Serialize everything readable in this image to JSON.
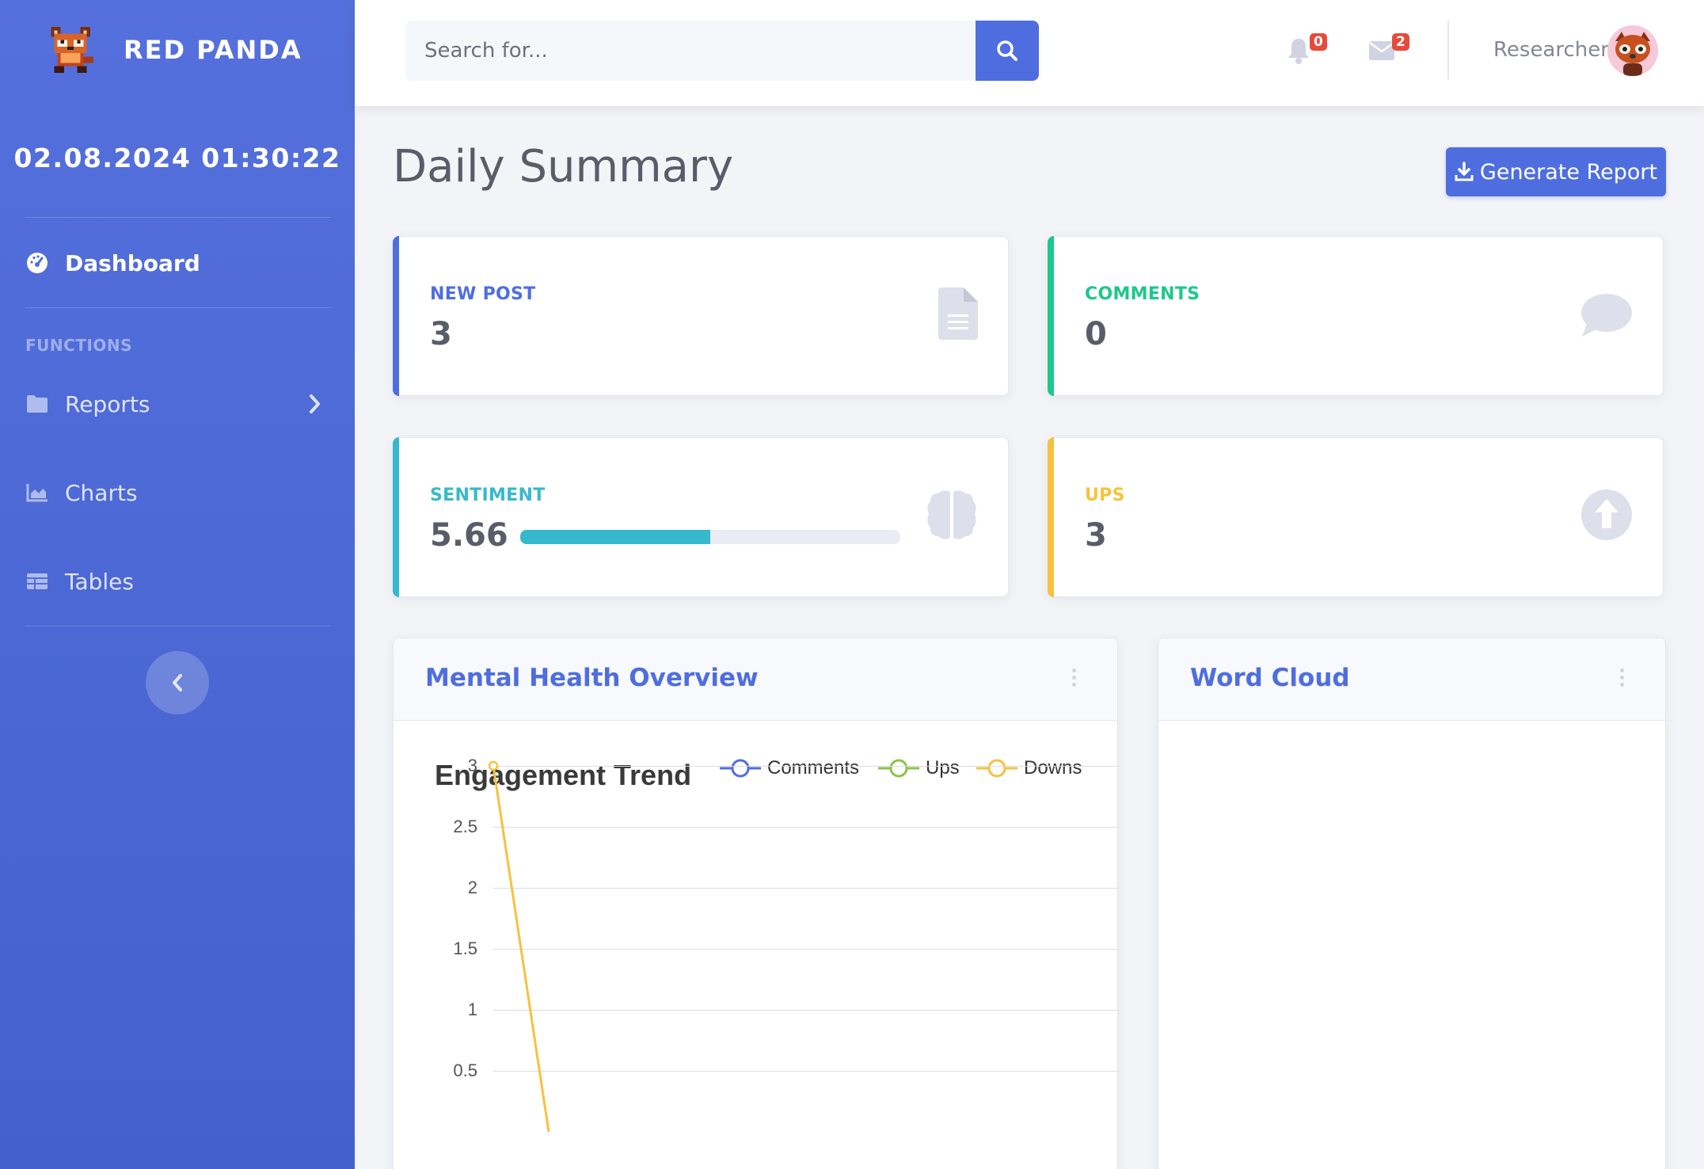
{
  "sidebar": {
    "brand": "RED PANDA",
    "clock": "02.08.2024 01:30:22",
    "dashboard_label": "Dashboard",
    "section_heading": "FUNCTIONS",
    "items": [
      {
        "label": "Reports"
      },
      {
        "label": "Charts"
      },
      {
        "label": "Tables"
      }
    ]
  },
  "topbar": {
    "search_placeholder": "Search for...",
    "alerts_count": "0",
    "messages_count": "2",
    "user_name": "Researcher"
  },
  "main": {
    "title": "Daily Summary",
    "generate_report": "Generate Report",
    "cards": {
      "new_post": {
        "label": "NEW POST",
        "value": "3",
        "color": "#4e6ee0"
      },
      "comments": {
        "label": "COMMENTS",
        "value": "0",
        "color": "#1cc88a"
      },
      "sentiment": {
        "label": "SENTIMENT",
        "value": "5.66",
        "progress": 0.5,
        "color": "#36b9cc"
      },
      "ups": {
        "label": "UPS",
        "value": "3",
        "color": "#f6c23e"
      }
    },
    "overview_panel": {
      "title": "Mental Health Overview"
    },
    "wordcloud_panel": {
      "title": "Word Cloud"
    }
  },
  "chart_data": {
    "type": "line",
    "title": "Engagement Trend",
    "y_ticks": [
      "3",
      "2.5",
      "2",
      "1.5",
      "1",
      "0.5"
    ],
    "ylim": [
      0,
      3
    ],
    "series": [
      {
        "name": "Comments",
        "color": "#4e6ee0"
      },
      {
        "name": "Ups",
        "color": "#8bc34a"
      },
      {
        "name": "Downs",
        "color": "#f6c23e",
        "values": [
          3,
          0
        ]
      }
    ],
    "grid": true,
    "legend_position": "top-right"
  }
}
